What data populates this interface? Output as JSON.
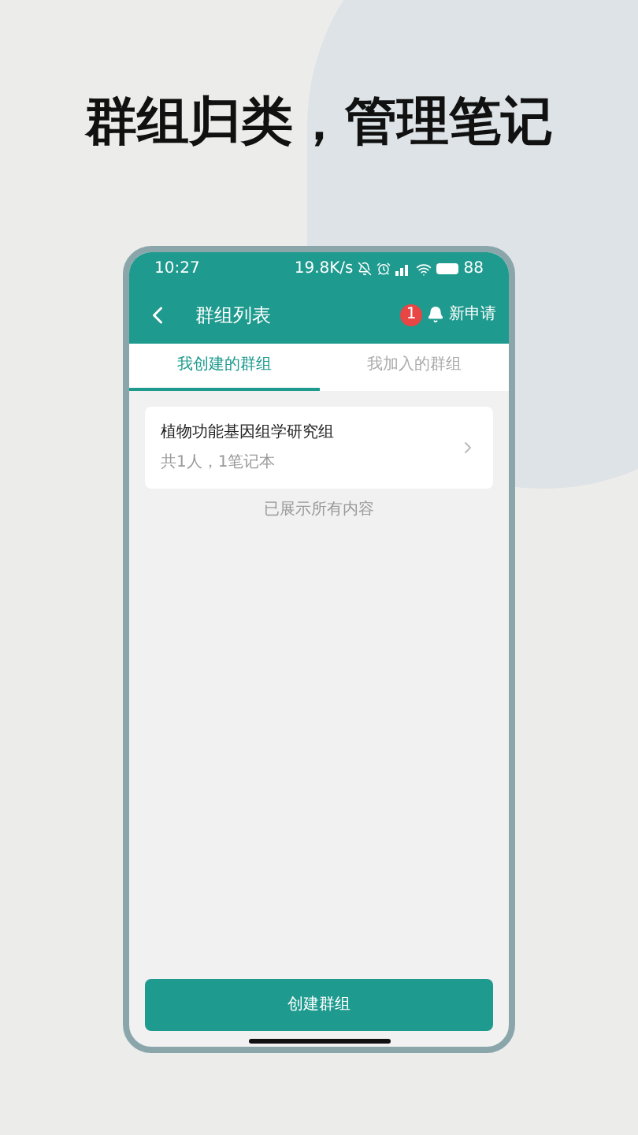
{
  "headline": "群组归类，管理笔记",
  "status_bar": {
    "time": "10:27",
    "speed": "19.8K/s",
    "battery": "88"
  },
  "header": {
    "title": "群组列表",
    "badge": "1",
    "action": "新申请"
  },
  "tabs": [
    {
      "label": "我创建的群组",
      "selected": true
    },
    {
      "label": "我加入的群组",
      "selected": false
    }
  ],
  "groups": [
    {
      "name": "植物功能基因组学研究组",
      "meta": "共1人，1笔记本"
    }
  ],
  "end_note": "已展示所有内容",
  "create_button": "创建群组"
}
